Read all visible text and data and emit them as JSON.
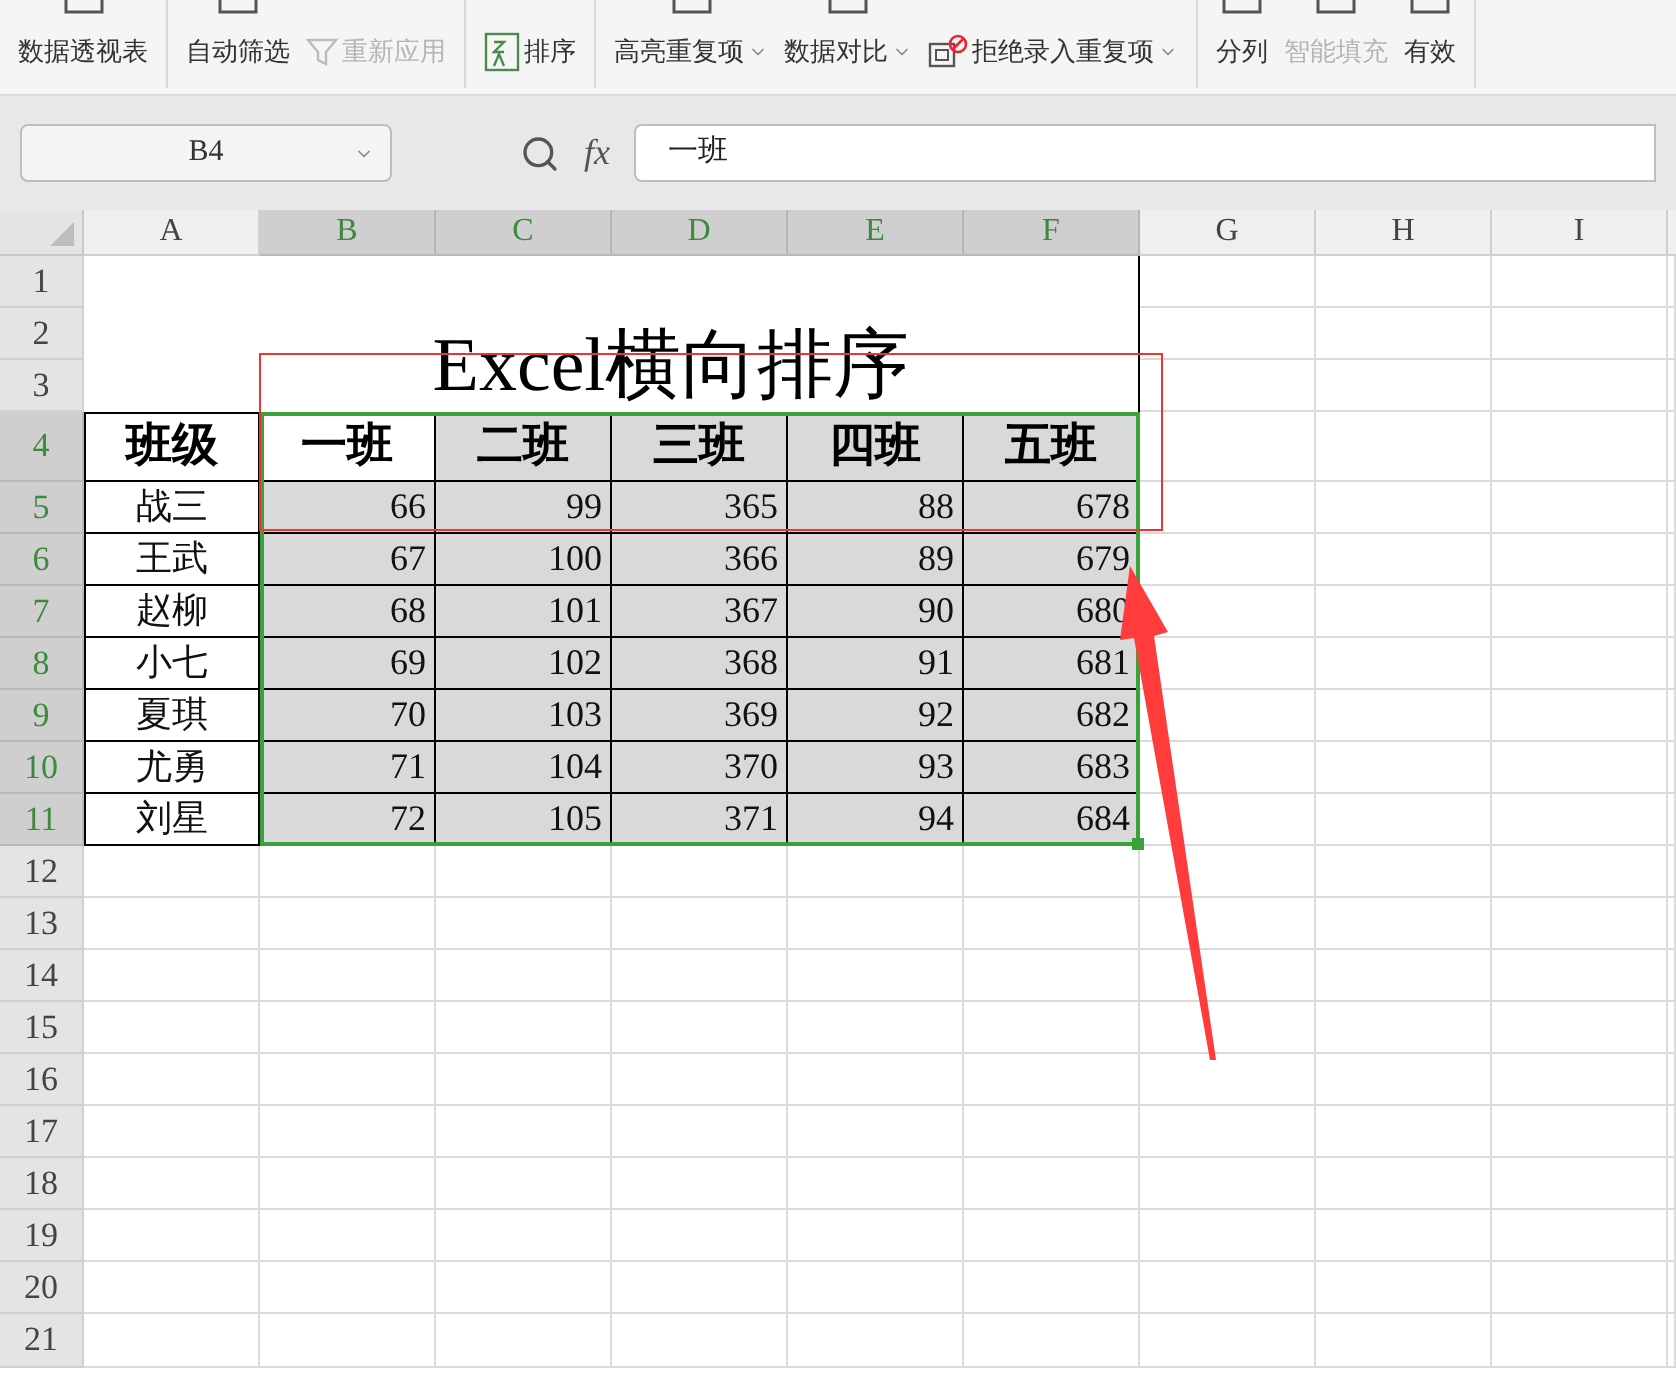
{
  "ribbon": {
    "groups": [
      {
        "items": [
          {
            "label": "数据透视表",
            "kind": "top",
            "disabled": false,
            "dropdown": false
          }
        ]
      },
      {
        "items": [
          {
            "label": "自动筛选",
            "kind": "top",
            "disabled": false,
            "dropdown": false
          },
          {
            "label": "重新应用",
            "kind": "filter",
            "disabled": true,
            "dropdown": false
          }
        ]
      },
      {
        "items": [
          {
            "label": "排序",
            "kind": "sort",
            "disabled": false,
            "dropdown": false
          }
        ]
      },
      {
        "items": [
          {
            "label": "高亮重复项",
            "kind": "top",
            "disabled": false,
            "dropdown": true
          },
          {
            "label": "数据对比",
            "kind": "top",
            "disabled": false,
            "dropdown": true
          },
          {
            "label": "拒绝录入重复项",
            "kind": "reject",
            "disabled": false,
            "dropdown": true
          }
        ]
      },
      {
        "items": [
          {
            "label": "分列",
            "kind": "top",
            "disabled": false,
            "dropdown": false
          },
          {
            "label": "智能填充",
            "kind": "top",
            "disabled": true,
            "dropdown": false
          },
          {
            "label": "有效",
            "kind": "top",
            "disabled": false,
            "dropdown": false
          }
        ]
      }
    ]
  },
  "name_box": {
    "value": "B4"
  },
  "formula_bar": {
    "fx": "fx",
    "value": "一班"
  },
  "sheet": {
    "columns": [
      {
        "label": "A",
        "selected": false
      },
      {
        "label": "B",
        "selected": true
      },
      {
        "label": "C",
        "selected": true
      },
      {
        "label": "D",
        "selected": true
      },
      {
        "label": "E",
        "selected": true
      },
      {
        "label": "F",
        "selected": true
      },
      {
        "label": "G",
        "selected": false
      },
      {
        "label": "H",
        "selected": false
      },
      {
        "label": "I",
        "selected": false
      }
    ],
    "row_numbers": [
      {
        "label": "1",
        "selected": false
      },
      {
        "label": "2",
        "selected": false
      },
      {
        "label": "3",
        "selected": false
      },
      {
        "label": "4",
        "selected": true
      },
      {
        "label": "5",
        "selected": true
      },
      {
        "label": "6",
        "selected": true
      },
      {
        "label": "7",
        "selected": true
      },
      {
        "label": "8",
        "selected": true
      },
      {
        "label": "9",
        "selected": true
      },
      {
        "label": "10",
        "selected": true
      },
      {
        "label": "11",
        "selected": true
      },
      {
        "label": "12",
        "selected": false
      },
      {
        "label": "13",
        "selected": false
      },
      {
        "label": "14",
        "selected": false
      },
      {
        "label": "15",
        "selected": false
      },
      {
        "label": "16",
        "selected": false
      },
      {
        "label": "17",
        "selected": false
      },
      {
        "label": "18",
        "selected": false
      },
      {
        "label": "19",
        "selected": false
      },
      {
        "label": "20",
        "selected": false
      },
      {
        "label": "21",
        "selected": false
      }
    ],
    "title": "Excel横向排序",
    "table": {
      "header": [
        "班级",
        "一班",
        "二班",
        "三班",
        "四班",
        "五班"
      ],
      "rows": [
        [
          "战三",
          "66",
          "99",
          "365",
          "88",
          "678"
        ],
        [
          "王武",
          "67",
          "100",
          "366",
          "89",
          "679"
        ],
        [
          "赵柳",
          "68",
          "101",
          "367",
          "90",
          "680"
        ],
        [
          "小七",
          "69",
          "102",
          "368",
          "91",
          "681"
        ],
        [
          "夏琪",
          "70",
          "103",
          "369",
          "92",
          "682"
        ],
        [
          "尤勇",
          "71",
          "104",
          "370",
          "93",
          "683"
        ],
        [
          "刘星",
          "72",
          "105",
          "371",
          "94",
          "684"
        ]
      ]
    }
  }
}
